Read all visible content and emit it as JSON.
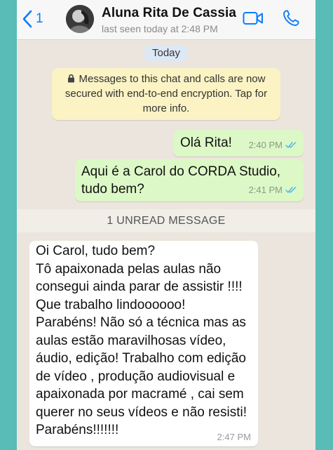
{
  "header": {
    "back_count": "1",
    "contact_name": "Aluna Rita De Cassia",
    "last_seen": "last seen today at 2:48 PM"
  },
  "chat": {
    "date_chip": "Today",
    "encryption_notice": [
      "Messages to this chat and calls are now",
      "secured with end-to-end encryption. Tap for",
      "more info."
    ],
    "outgoing": [
      {
        "lines": [
          "Olá Rita!"
        ],
        "time": "2:40 PM",
        "status": "read"
      },
      {
        "lines": [
          "Aqui é a Carol do CORDA Studio,",
          "tudo bem?"
        ],
        "time": "2:41 PM",
        "status": "read"
      }
    ],
    "unread_banner": "1 UNREAD MESSAGE",
    "incoming": {
      "lines": [
        "Oi Carol, tudo bem?",
        "Tô apaixonada pelas aulas não",
        "consegui ainda parar de assistir !!!!",
        "Que trabalho lindoooooo!",
        "Parabéns! Não só a técnica mas as",
        "aulas estão maravilhosas vídeo,",
        "áudio, edição! Trabalho com edição",
        "de vídeo , produção audiovisual e",
        "apaixonada por macramé , cai sem",
        "querer no seus vídeos e não resisti!",
        "Parabéns!!!!!!!"
      ],
      "time": "2:47 PM"
    }
  },
  "colors": {
    "accent": "#0a7cff",
    "outgoing_bubble": "#dcf8c6",
    "incoming_bubble": "#ffffff",
    "chat_background": "#ece5dd",
    "read_ticks": "#4fb6ec",
    "outer_background": "#59bcb6"
  },
  "icons": {
    "back": "chevron-left-icon",
    "video": "video-camera-icon",
    "call": "phone-icon",
    "lock": "lock-icon",
    "ticks": "double-check-icon"
  }
}
